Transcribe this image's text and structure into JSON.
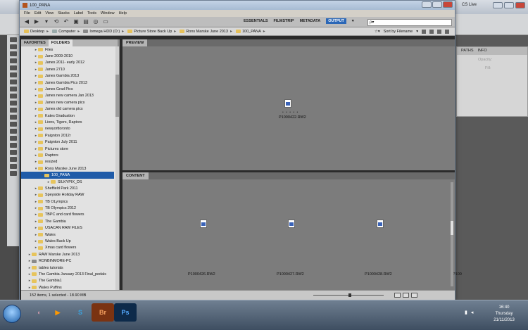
{
  "photoshop": {
    "cs_live": "CS Live",
    "panel_tabs": [
      "PATHS",
      "INFO"
    ],
    "panel_fields": [
      "Opacity:",
      "Fill:"
    ]
  },
  "bridge": {
    "title": "100_PANA",
    "menu": [
      "File",
      "Edit",
      "View",
      "Stacks",
      "Label",
      "Tools",
      "Window",
      "Help"
    ],
    "workspaces": [
      "ESSENTIALS",
      "FILMSTRIP",
      "METADATA",
      "OUTPUT"
    ],
    "active_workspace": "OUTPUT",
    "search_placeholder": "ρ▾",
    "breadcrumbs": [
      "Desktop",
      "Computer",
      "Iomega HDD (O:)",
      "Picture Store Back Up",
      "Rons Marske June 2013",
      "100_PANA"
    ],
    "sort_label": "Sort by Filename",
    "left_tabs": [
      "FAVORITES",
      "FOLDERS"
    ],
    "active_left_tab": "FOLDERS",
    "tree": [
      {
        "label": "Files",
        "indent": 2
      },
      {
        "label": "Jane 2009-2010",
        "indent": 2
      },
      {
        "label": "Janes 2011- early 2012",
        "indent": 2
      },
      {
        "label": "Janes 2710",
        "indent": 2
      },
      {
        "label": "Janes Gambia 2013",
        "indent": 2
      },
      {
        "label": "Janes Gambia Pics 2013",
        "indent": 2
      },
      {
        "label": "Janes Grad Pics",
        "indent": 2
      },
      {
        "label": "Janes new camera Jan 2013",
        "indent": 2
      },
      {
        "label": "Janes new camera pics",
        "indent": 2
      },
      {
        "label": "Janes old camera pics",
        "indent": 2
      },
      {
        "label": "Kates Graduation",
        "indent": 2
      },
      {
        "label": "Lions, Tigers, Raptors",
        "indent": 2
      },
      {
        "label": "newyorttoronto",
        "indent": 2
      },
      {
        "label": "Paignton 2012r",
        "indent": 2
      },
      {
        "label": "Paignton July 2011",
        "indent": 2
      },
      {
        "label": "Pictures store",
        "indent": 2
      },
      {
        "label": "Raptors",
        "indent": 2
      },
      {
        "label": "resized",
        "indent": 2
      },
      {
        "label": "Rons Marske June 2013",
        "indent": 2,
        "expanded": true
      },
      {
        "label": "100_PANA",
        "indent": 3,
        "selected": true,
        "expanded": true
      },
      {
        "label": "SILKYPIX_DS",
        "indent": 4
      },
      {
        "label": "Sheffield Park 2011",
        "indent": 2
      },
      {
        "label": "Speyside Holiday RAW",
        "indent": 2
      },
      {
        "label": "TB OLympics",
        "indent": 2
      },
      {
        "label": "TB Olympics 2012",
        "indent": 2
      },
      {
        "label": "TBPC and card flowers",
        "indent": 2
      },
      {
        "label": "The Gambia",
        "indent": 2
      },
      {
        "label": "USACAN RAW FILES",
        "indent": 2
      },
      {
        "label": "Wales",
        "indent": 2
      },
      {
        "label": "Wales Back Up",
        "indent": 2
      },
      {
        "label": "Xmas card flowers",
        "indent": 2
      },
      {
        "label": "RAW Marske June 2013",
        "indent": 1
      },
      {
        "label": "RONBINMORE-PC",
        "indent": 1,
        "pc": true
      },
      {
        "label": "tables tutorials",
        "indent": 1
      },
      {
        "label": "The Gambia January 2013 Final_pedals",
        "indent": 1
      },
      {
        "label": "The Gambia1",
        "indent": 1
      },
      {
        "label": "Wales Puffins",
        "indent": 1
      }
    ],
    "preview_tab": "PREVIEW",
    "preview_file": "P1000422.RW2",
    "content_tab": "CONTENT",
    "content_files": [
      "P1000426.RW2",
      "P1000427.RW2",
      "P1000428.RW2",
      "P100"
    ],
    "status": "152 items, 1 selected - 18.90 MB"
  },
  "taskbar": {
    "apps": [
      "Br",
      "Ps"
    ],
    "time": "16:40",
    "day": "Thursday",
    "date": "21/11/2013"
  }
}
